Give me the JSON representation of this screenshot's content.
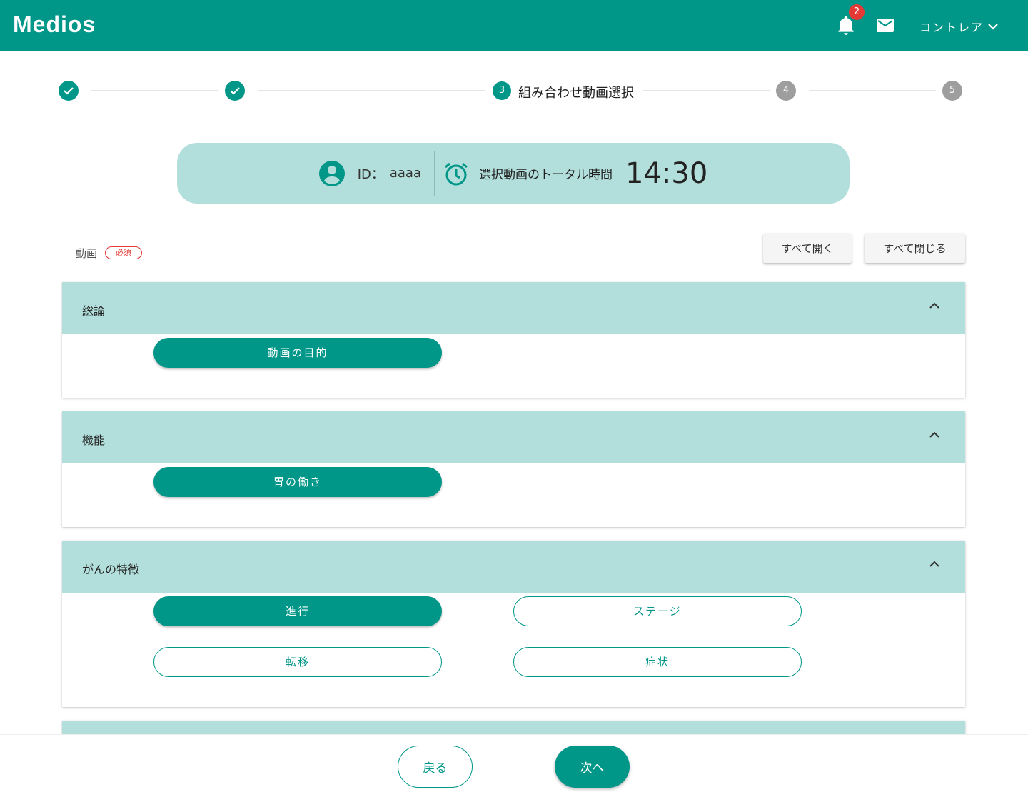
{
  "header": {
    "logo": "Medios",
    "notification_count": "2",
    "user_name": "コントレア"
  },
  "stepper": {
    "steps": [
      {
        "state": "done"
      },
      {
        "state": "done"
      },
      {
        "number": "3",
        "label": "組み合わせ動画選択",
        "state": "current"
      },
      {
        "number": "4",
        "state": "todo"
      },
      {
        "number": "5",
        "state": "todo"
      }
    ]
  },
  "info": {
    "id_label": "ID：",
    "id_value": "aaaa",
    "total_label": "選択動画のトータル時間",
    "total_time": "14:30"
  },
  "section": {
    "label": "動画",
    "required": "必須",
    "expand_all": "すべて開く",
    "collapse_all": "すべて閉じる"
  },
  "panels": [
    {
      "title": "総論",
      "items": [
        {
          "label": "動画の目的",
          "selected": true
        }
      ]
    },
    {
      "title": "機能",
      "items": [
        {
          "label": "胃の働き",
          "selected": true
        }
      ]
    },
    {
      "title": "がんの特徴",
      "items": [
        {
          "label": "進行",
          "selected": true
        },
        {
          "label": "ステージ",
          "selected": false
        },
        {
          "label": "転移",
          "selected": false
        },
        {
          "label": "症状",
          "selected": false
        }
      ]
    }
  ],
  "footer": {
    "back": "戻る",
    "next": "次へ"
  },
  "colors": {
    "primary": "#009688",
    "light": "#b2dfdb",
    "required": "#e53935"
  }
}
